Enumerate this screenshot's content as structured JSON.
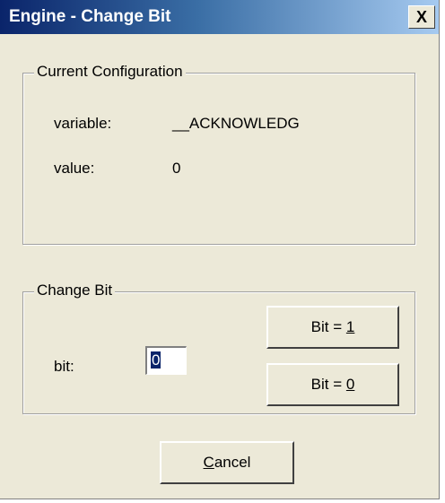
{
  "window": {
    "title": "Engine - Change Bit",
    "close_glyph": "X"
  },
  "current_config": {
    "title": "Current Configuration",
    "variable_label": "variable:",
    "variable_value": "__ACKNOWLEDG",
    "value_label": "value:",
    "value_value": "0"
  },
  "change_bit": {
    "title": "Change Bit",
    "bit_label": "bit:",
    "bit_value": "0",
    "bit1_prefix": "Bit = ",
    "bit1_mnemonic": "1",
    "bit0_prefix": "Bit = ",
    "bit0_mnemonic": "0"
  },
  "cancel": {
    "mnemonic": "C",
    "rest": "ancel"
  },
  "colors": {
    "face": "#ece9d8",
    "title_gradient_start": "#0a246a",
    "title_gradient_end": "#a6caf0",
    "selection": "#0a246a"
  }
}
